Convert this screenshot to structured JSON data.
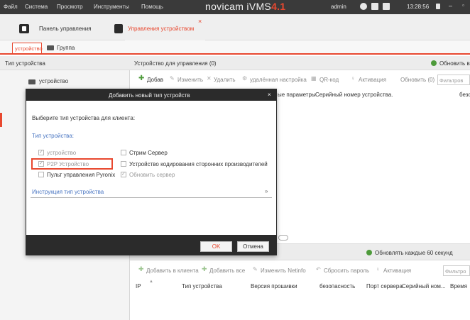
{
  "titlebar": {
    "menu": [
      "Файл",
      "Система",
      "Просмотр",
      "Инструменты",
      "Помощь"
    ],
    "brand": "novicam iVMS",
    "brand_version": "4.1",
    "user": "admin",
    "time": "13:28:56",
    "minimize": "–",
    "maximize": "▫"
  },
  "tabs": {
    "control_panel": "Панель управления",
    "device_management": "Управления устройством",
    "close": "×"
  },
  "subtabs": {
    "device": "устройство",
    "group": "Группа"
  },
  "left_panel": {
    "header": "Тип устройства",
    "item": "устройство"
  },
  "right_panel": {
    "title": "Устройство для управления (0)",
    "refresh_all": "Обновить в",
    "toolbar": {
      "add": "Добав",
      "edit": "Изменить",
      "delete": "Удалить",
      "remote_config": "удалённая настройка",
      "qr": "QR-код",
      "activate": "Активация",
      "refresh": "Обновить (0)",
      "filter_placeholder": "Фильтров"
    },
    "columns": [
      "ые параметры",
      "Серийный номер устройства.",
      "безо"
    ]
  },
  "bottom": {
    "auto_refresh": "Обновлять каждые 60 секунд",
    "toolbar": {
      "add_to_client": "Добавить в клиента",
      "add_all": "Добавить все",
      "change_netinfo": "Изменить Netinfo",
      "reset_password": "Сбросить пароль",
      "activate": "Активация",
      "filter_placeholder": "Фильтро"
    },
    "columns": [
      "IP",
      "Тип устройства",
      "Версия прошивки",
      "безопасность",
      "Порт сервера",
      "Серийный ном...",
      "Время"
    ]
  },
  "modal": {
    "title": "Добавить новый тип устройств",
    "close": "×",
    "instruction": "Выберите тип устройства для клиента:",
    "type_label": "Тип устройства:",
    "options": {
      "device": "устройство",
      "p2p": "P2P Устройство",
      "pyronix": "Пульт управления Pyronix",
      "stream": "Стрим Сервер",
      "third_party": "Устройство кодирования сторонних производителей",
      "update_server": "Обновить сервер"
    },
    "instruction_link": "Инструкция тип устройства",
    "expand": "»",
    "ok": "OK",
    "cancel": "Отмена"
  },
  "colors": {
    "accent": "#e8482f",
    "titlebar": "#3a3a3a",
    "link": "#4a76c2",
    "refresh_green": "#4e9b3b"
  }
}
